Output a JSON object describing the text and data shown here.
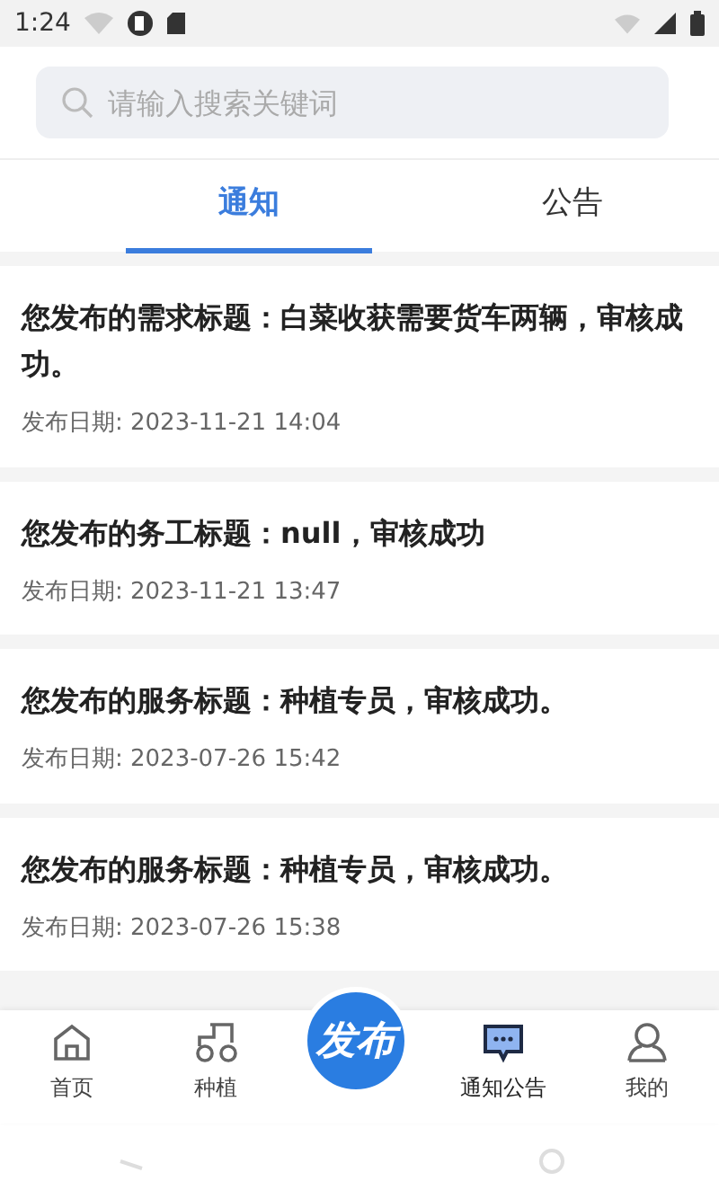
{
  "status_bar": {
    "time": "1:24"
  },
  "search": {
    "placeholder": "请输入搜索关键词"
  },
  "tabs": [
    {
      "label": "通知",
      "selected": true
    },
    {
      "label": "公告",
      "selected": false
    }
  ],
  "notices": [
    {
      "title": "您发布的需求标题：白菜收获需要货车两辆，审核成功。",
      "date": "发布日期: 2023-11-21 14:04"
    },
    {
      "title": "您发布的务工标题：null，审核成功",
      "date": "发布日期: 2023-11-21 13:47"
    },
    {
      "title": "您发布的服务标题：种植专员，审核成功。",
      "date": "发布日期: 2023-07-26 15:42"
    },
    {
      "title": "您发布的服务标题：种植专员，审核成功。",
      "date": "发布日期: 2023-07-26 15:38"
    }
  ],
  "bottom_nav": [
    {
      "kind": "home",
      "label": "首页",
      "selected": false
    },
    {
      "kind": "tractor",
      "label": "种植",
      "selected": false
    },
    {
      "kind": "publish",
      "label": "发布",
      "selected": false
    },
    {
      "kind": "messages",
      "label": "通知公告",
      "selected": true
    },
    {
      "kind": "profile",
      "label": "我的",
      "selected": false
    }
  ]
}
